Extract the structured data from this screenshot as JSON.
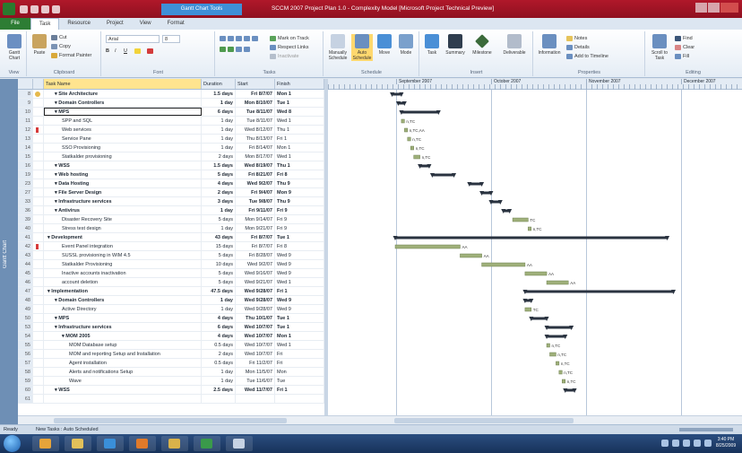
{
  "window": {
    "context_tab": "Gantt Chart Tools",
    "title": "SCCM 2007 Project Plan 1.0 - Complexity Model [Microsoft Project Technical Preview]"
  },
  "ribbon": {
    "file_tab": "File",
    "tabs": [
      "Task",
      "Resource",
      "Project",
      "View",
      "Format"
    ],
    "groups": {
      "view": "View",
      "clipboard": "Clipboard",
      "font": "Font",
      "tasks": "Tasks",
      "schedule": "Schedule",
      "insert": "Insert",
      "properties": "Properties",
      "editing": "Editing"
    },
    "buttons": {
      "gantt_chart": "Gantt Chart",
      "paste": "Paste",
      "cut": "Cut",
      "copy": "Copy",
      "format_painter": "Format Painter",
      "font_name": "Arial",
      "font_size": "8",
      "mark_on_track": "Mark on Track",
      "respect_links": "Respect Links",
      "inactivate": "Inactivate",
      "manually_schedule": "Manually Schedule",
      "auto_schedule": "Auto Schedule",
      "move": "Move",
      "mode": "Mode",
      "task": "Task",
      "summary": "Summary",
      "milestone": "Milestone",
      "deliverable": "Deliverable",
      "information": "Information",
      "notes": "Notes",
      "details": "Details",
      "add_to_timeline": "Add to Timeline",
      "scroll_to_task": "Scroll to Task",
      "find": "Find",
      "clear": "Clear",
      "fill": "Fill"
    }
  },
  "view_bar": {
    "label": "Gantt Chart"
  },
  "table": {
    "headers": {
      "task_name": "Task Name",
      "duration": "Duration",
      "start": "Start",
      "finish": "Finish"
    },
    "rows": [
      {
        "id": "8",
        "flag": "note",
        "name": "Site Architecture",
        "level": 1,
        "summary": true,
        "duration": "1.5 days",
        "start": "Fri 8/7/07",
        "finish": "Mon 1"
      },
      {
        "id": "9",
        "flag": "",
        "name": "Domain Controllers",
        "level": 1,
        "summary": true,
        "duration": "1 day",
        "start": "Mon 8/10/07",
        "finish": "Tue 1"
      },
      {
        "id": "10",
        "flag": "",
        "name": "MPS",
        "level": 1,
        "summary": true,
        "duration": "6 days",
        "start": "Tue 8/11/07",
        "finish": "Wed 8",
        "selected": true
      },
      {
        "id": "11",
        "flag": "",
        "name": "SPP and SQL",
        "level": 2,
        "summary": false,
        "duration": "1 day",
        "start": "Tue 8/11/07",
        "finish": "Wed 1"
      },
      {
        "id": "12",
        "flag": "red",
        "name": "Web services",
        "level": 2,
        "summary": false,
        "duration": "1 day",
        "start": "Wed 8/12/07",
        "finish": "Thu 1"
      },
      {
        "id": "13",
        "flag": "",
        "name": "Service Pane",
        "level": 2,
        "summary": false,
        "duration": "1 day",
        "start": "Thu 8/13/07",
        "finish": "Fri 1"
      },
      {
        "id": "14",
        "flag": "",
        "name": "SSO Provisioning",
        "level": 2,
        "summary": false,
        "duration": "1 day",
        "start": "Fri 8/14/07",
        "finish": "Mon 1"
      },
      {
        "id": "15",
        "flag": "",
        "name": "Statkalder provisioning",
        "level": 2,
        "summary": false,
        "duration": "2 days",
        "start": "Mon 8/17/07",
        "finish": "Wed 1"
      },
      {
        "id": "16",
        "flag": "",
        "name": "WSS",
        "level": 1,
        "summary": true,
        "duration": "1.5 days",
        "start": "Wed 8/19/07",
        "finish": "Thu 1"
      },
      {
        "id": "19",
        "flag": "",
        "name": "Web hosting",
        "level": 1,
        "summary": true,
        "duration": "5 days",
        "start": "Fri 8/21/07",
        "finish": "Fri 8"
      },
      {
        "id": "23",
        "flag": "",
        "name": "Data Hosting",
        "level": 1,
        "summary": true,
        "duration": "4 days",
        "start": "Wed 9/2/07",
        "finish": "Thu 9"
      },
      {
        "id": "27",
        "flag": "",
        "name": "File Server Design",
        "level": 1,
        "summary": true,
        "duration": "2 days",
        "start": "Fri 9/4/07",
        "finish": "Mon 9"
      },
      {
        "id": "33",
        "flag": "",
        "name": "Infrastructure services",
        "level": 1,
        "summary": true,
        "duration": "3 days",
        "start": "Tue 9/8/07",
        "finish": "Thu 9"
      },
      {
        "id": "36",
        "flag": "",
        "name": "Antivirus",
        "level": 1,
        "summary": true,
        "duration": "1 day",
        "start": "Fri 9/11/07",
        "finish": "Fri 9"
      },
      {
        "id": "39",
        "flag": "",
        "name": "Disaster Recovery Site",
        "level": 2,
        "summary": false,
        "duration": "5 days",
        "start": "Mon 9/14/07",
        "finish": "Fri 9"
      },
      {
        "id": "40",
        "flag": "",
        "name": "Stress test design",
        "level": 2,
        "summary": false,
        "duration": "1 day",
        "start": "Mon 9/21/07",
        "finish": "Fri 9"
      },
      {
        "id": "41",
        "flag": "",
        "name": "Development",
        "level": 0,
        "summary": true,
        "duration": "43 days",
        "start": "Fri 8/7/07",
        "finish": "Tue 1"
      },
      {
        "id": "42",
        "flag": "red",
        "name": "Event Panel integration",
        "level": 2,
        "summary": false,
        "duration": "15 days",
        "start": "Fri 8/7/07",
        "finish": "Fri 8"
      },
      {
        "id": "43",
        "flag": "",
        "name": "SUSSL provisioning in WIM 4.5",
        "level": 2,
        "summary": false,
        "duration": "5 days",
        "start": "Fri 8/28/07",
        "finish": "Wed 9"
      },
      {
        "id": "44",
        "flag": "",
        "name": "Statkalder Provisioning",
        "level": 2,
        "summary": false,
        "duration": "10 days",
        "start": "Wed 9/2/07",
        "finish": "Wed 9"
      },
      {
        "id": "45",
        "flag": "",
        "name": "Inactive accounts inactivation",
        "level": 2,
        "summary": false,
        "duration": "5 days",
        "start": "Wed 9/16/07",
        "finish": "Wed 9"
      },
      {
        "id": "46",
        "flag": "",
        "name": "account deletion",
        "level": 2,
        "summary": false,
        "duration": "5 days",
        "start": "Wed 9/21/07",
        "finish": "Wed 1"
      },
      {
        "id": "47",
        "flag": "",
        "name": "Implementation",
        "level": 0,
        "summary": true,
        "duration": "47.5 days",
        "start": "Wed 9/28/07",
        "finish": "Fri 1"
      },
      {
        "id": "48",
        "flag": "",
        "name": "Domain Controllers",
        "level": 1,
        "summary": true,
        "duration": "1 day",
        "start": "Wed 9/28/07",
        "finish": "Wed 9"
      },
      {
        "id": "49",
        "flag": "",
        "name": "Active Directory",
        "level": 2,
        "summary": false,
        "duration": "1 day",
        "start": "Wed 9/28/07",
        "finish": "Wed 9"
      },
      {
        "id": "50",
        "flag": "",
        "name": "MPS",
        "level": 1,
        "summary": true,
        "duration": "4 days",
        "start": "Thu 10/1/07",
        "finish": "Tue 1"
      },
      {
        "id": "53",
        "flag": "",
        "name": "Infrastructure services",
        "level": 1,
        "summary": true,
        "duration": "6 days",
        "start": "Wed 10/7/07",
        "finish": "Tue 1"
      },
      {
        "id": "54",
        "flag": "",
        "name": "MOM 2005",
        "level": 2,
        "summary": true,
        "duration": "4 days",
        "start": "Wed 10/7/07",
        "finish": "Mon 1"
      },
      {
        "id": "55",
        "flag": "",
        "name": "MOM Database setup",
        "level": 3,
        "summary": false,
        "duration": "0.5 days",
        "start": "Wed 10/7/07",
        "finish": "Wed 1"
      },
      {
        "id": "56",
        "flag": "",
        "name": "MOM and reporting Setup and Installation",
        "level": 3,
        "summary": false,
        "duration": "2 days",
        "start": "Wed 10/7/07",
        "finish": "Fri"
      },
      {
        "id": "57",
        "flag": "",
        "name": "Agent installation",
        "level": 3,
        "summary": false,
        "duration": "0.5 days",
        "start": "Fri 11/2/07",
        "finish": "Fri"
      },
      {
        "id": "58",
        "flag": "",
        "name": "Alerts and notifications Setup",
        "level": 3,
        "summary": false,
        "duration": "1 day",
        "start": "Mon 11/5/07",
        "finish": "Mon"
      },
      {
        "id": "59",
        "flag": "",
        "name": "Wave",
        "level": 3,
        "summary": false,
        "duration": "1 day",
        "start": "Tue 11/6/07",
        "finish": "Tue"
      },
      {
        "id": "60",
        "flag": "",
        "name": "WSS",
        "level": 1,
        "summary": true,
        "duration": "2.5 days",
        "start": "Wed 11/7/07",
        "finish": "Fri 1"
      },
      {
        "id": "61",
        "flag": "",
        "name": "",
        "level": 1,
        "summary": false,
        "duration": "",
        "start": "",
        "finish": ""
      }
    ]
  },
  "timescale": {
    "months": [
      "September 2007",
      "October 2007",
      "November 2007",
      "December 2007"
    ]
  },
  "gantt": {
    "rows": [
      {
        "kind": "summary",
        "start": 19,
        "end": 22
      },
      {
        "kind": "summary",
        "start": 21,
        "end": 23
      },
      {
        "kind": "summary",
        "start": 22,
        "end": 34
      },
      {
        "kind": "task",
        "start": 22,
        "end": 23,
        "label": "n,TC"
      },
      {
        "kind": "task",
        "start": 23,
        "end": 24,
        "label": "n,TC,AA"
      },
      {
        "kind": "task",
        "start": 24,
        "end": 25,
        "label": "n,TC"
      },
      {
        "kind": "task",
        "start": 25,
        "end": 26,
        "label": "n,TC"
      },
      {
        "kind": "task",
        "start": 26,
        "end": 28,
        "label": "n,TC"
      },
      {
        "kind": "summary",
        "start": 28,
        "end": 31
      },
      {
        "kind": "summary",
        "start": 32,
        "end": 39
      },
      {
        "kind": "summary",
        "start": 44,
        "end": 48
      },
      {
        "kind": "summary",
        "start": 48,
        "end": 51
      },
      {
        "kind": "summary",
        "start": 51,
        "end": 54
      },
      {
        "kind": "summary",
        "start": 55,
        "end": 57
      },
      {
        "kind": "task",
        "start": 58,
        "end": 63,
        "label": "TC"
      },
      {
        "kind": "task",
        "start": 63,
        "end": 64,
        "label": "n,TC"
      },
      {
        "kind": "summary",
        "start": 20,
        "end": 108
      },
      {
        "kind": "task",
        "start": 20,
        "end": 41,
        "label": "AA"
      },
      {
        "kind": "task",
        "start": 41,
        "end": 48,
        "label": "AA"
      },
      {
        "kind": "task",
        "start": 48,
        "end": 62,
        "label": "AA"
      },
      {
        "kind": "task",
        "start": 62,
        "end": 69,
        "label": "AA"
      },
      {
        "kind": "task",
        "start": 69,
        "end": 76,
        "label": "AA"
      },
      {
        "kind": "summary",
        "start": 62,
        "end": 110
      },
      {
        "kind": "summary",
        "start": 62,
        "end": 64
      },
      {
        "kind": "task",
        "start": 62,
        "end": 64,
        "label": "TC"
      },
      {
        "kind": "summary",
        "start": 64,
        "end": 69
      },
      {
        "kind": "summary",
        "start": 69,
        "end": 77
      },
      {
        "kind": "summary",
        "start": 69,
        "end": 75
      },
      {
        "kind": "task",
        "start": 69,
        "end": 70,
        "label": "n,TC"
      },
      {
        "kind": "task",
        "start": 70,
        "end": 72,
        "label": "n,TC"
      },
      {
        "kind": "task",
        "start": 72,
        "end": 73,
        "label": "n,TC"
      },
      {
        "kind": "task",
        "start": 73,
        "end": 74,
        "label": "n,TC"
      },
      {
        "kind": "task",
        "start": 74,
        "end": 75,
        "label": "n,TC"
      },
      {
        "kind": "summary",
        "start": 75,
        "end": 78
      },
      {
        "kind": "none"
      }
    ]
  },
  "status": {
    "ready": "Ready",
    "new_tasks": "New Tasks : Auto Scheduled"
  },
  "taskbar": {
    "time": "3:40 PM",
    "date": "8/25/2009"
  }
}
